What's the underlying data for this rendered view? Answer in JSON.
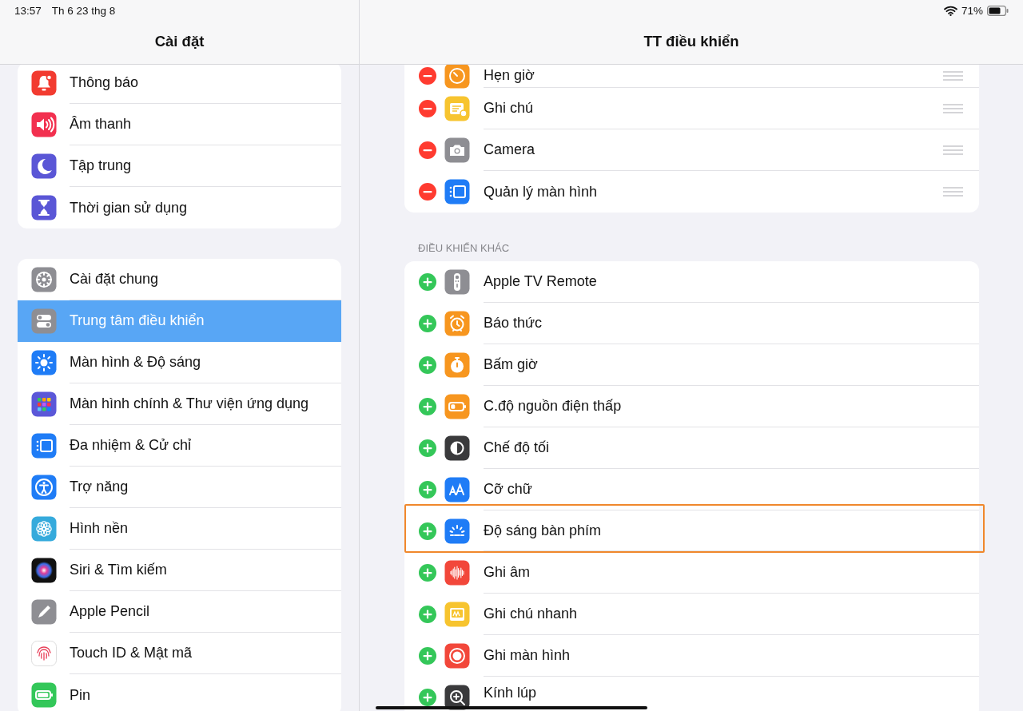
{
  "status_bar": {
    "time": "13:57",
    "date": "Th 6 23 thg 8",
    "battery": "71%"
  },
  "sidebar": {
    "title": "Cài đặt",
    "groups": [
      {
        "items": [
          {
            "label": "Thông báo",
            "selected": false
          },
          {
            "label": "Âm thanh",
            "selected": false
          },
          {
            "label": "Tập trung",
            "selected": false
          },
          {
            "label": "Thời gian sử dụng",
            "selected": false
          }
        ]
      },
      {
        "items": [
          {
            "label": "Cài đặt chung",
            "selected": false
          },
          {
            "label": "Trung tâm điều khiển",
            "selected": true
          },
          {
            "label": "Màn hình & Độ sáng",
            "selected": false
          },
          {
            "label": "Màn hình chính & Thư viện ứng dụng",
            "selected": false
          },
          {
            "label": "Đa nhiệm & Cử chỉ",
            "selected": false
          },
          {
            "label": "Trợ năng",
            "selected": false
          },
          {
            "label": "Hình nền",
            "selected": false
          },
          {
            "label": "Siri & Tìm kiếm",
            "selected": false
          },
          {
            "label": "Apple Pencil",
            "selected": false
          },
          {
            "label": "Touch ID & Mật mã",
            "selected": false
          },
          {
            "label": "Pin",
            "selected": false
          }
        ]
      }
    ]
  },
  "detail": {
    "title": "TT điều khiển",
    "sections": [
      {
        "kind": "included",
        "items": [
          {
            "label": "Hẹn giờ",
            "highlighted": false
          },
          {
            "label": "Ghi chú",
            "highlighted": false
          },
          {
            "label": "Camera",
            "highlighted": false
          },
          {
            "label": "Quản lý màn hình",
            "highlighted": false
          }
        ]
      },
      {
        "kind": "more",
        "header": "ĐIỀU KHIỂN KHÁC",
        "items": [
          {
            "label": "Apple TV Remote",
            "highlighted": false
          },
          {
            "label": "Báo thức",
            "highlighted": false
          },
          {
            "label": "Bấm giờ",
            "highlighted": false
          },
          {
            "label": "C.độ nguồn điện thấp",
            "highlighted": false
          },
          {
            "label": "Chế độ tối",
            "highlighted": false
          },
          {
            "label": "Cỡ chữ",
            "highlighted": false
          },
          {
            "label": "Độ sáng bàn phím",
            "highlighted": true
          },
          {
            "label": "Ghi âm",
            "highlighted": false
          },
          {
            "label": "Ghi chú nhanh",
            "highlighted": false
          },
          {
            "label": "Ghi màn hình",
            "highlighted": false
          },
          {
            "label": "Kính lúp",
            "highlighted": false
          }
        ]
      }
    ]
  }
}
